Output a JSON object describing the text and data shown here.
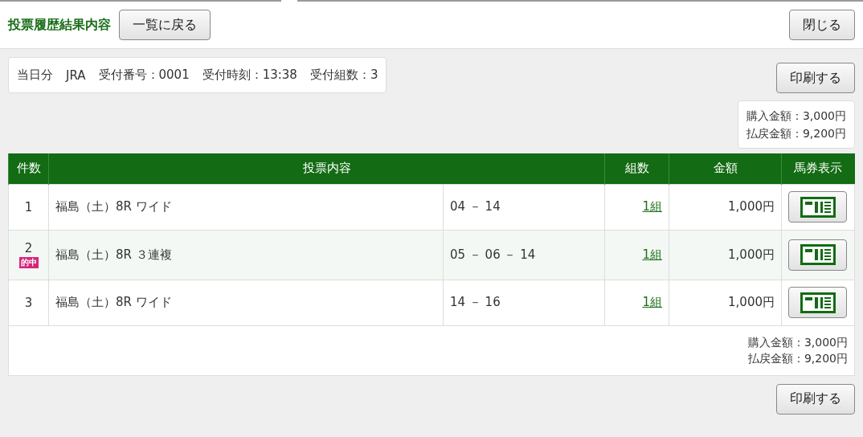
{
  "header": {
    "title": "投票履歴結果内容",
    "back_button": "一覧に戻る",
    "close_button": "閉じる"
  },
  "receipt": [
    "当日分",
    "JRA",
    "受付番号：0001",
    "受付時刻：13:38",
    "受付組数：3"
  ],
  "print_button_top": "印刷する",
  "summary_top": [
    "購入金額：3,000円",
    "払戻金額：9,200円"
  ],
  "table": {
    "columns": [
      "件数",
      "投票内容",
      "組数",
      "金額",
      "馬券表示"
    ],
    "rows": [
      {
        "number": "1",
        "race": "福島（土）8R ワイド",
        "horses": "04 － 14",
        "combos": "1組",
        "amount": "1,000円",
        "hit": false
      },
      {
        "number": "2",
        "badge": "的中",
        "race": "福島（土）8R ３連複",
        "horses": "05 － 06 － 14",
        "combos": "1組",
        "amount": "1,000円",
        "hit": true
      },
      {
        "number": "3",
        "race": "福島（土）8R ワイド",
        "horses": "14 － 16",
        "combos": "1組",
        "amount": "1,000円",
        "hit": false
      }
    ],
    "summary": [
      "購入金額：3,000円",
      "払戻金額：9,200円"
    ]
  },
  "print_button_bottom": "印刷する"
}
